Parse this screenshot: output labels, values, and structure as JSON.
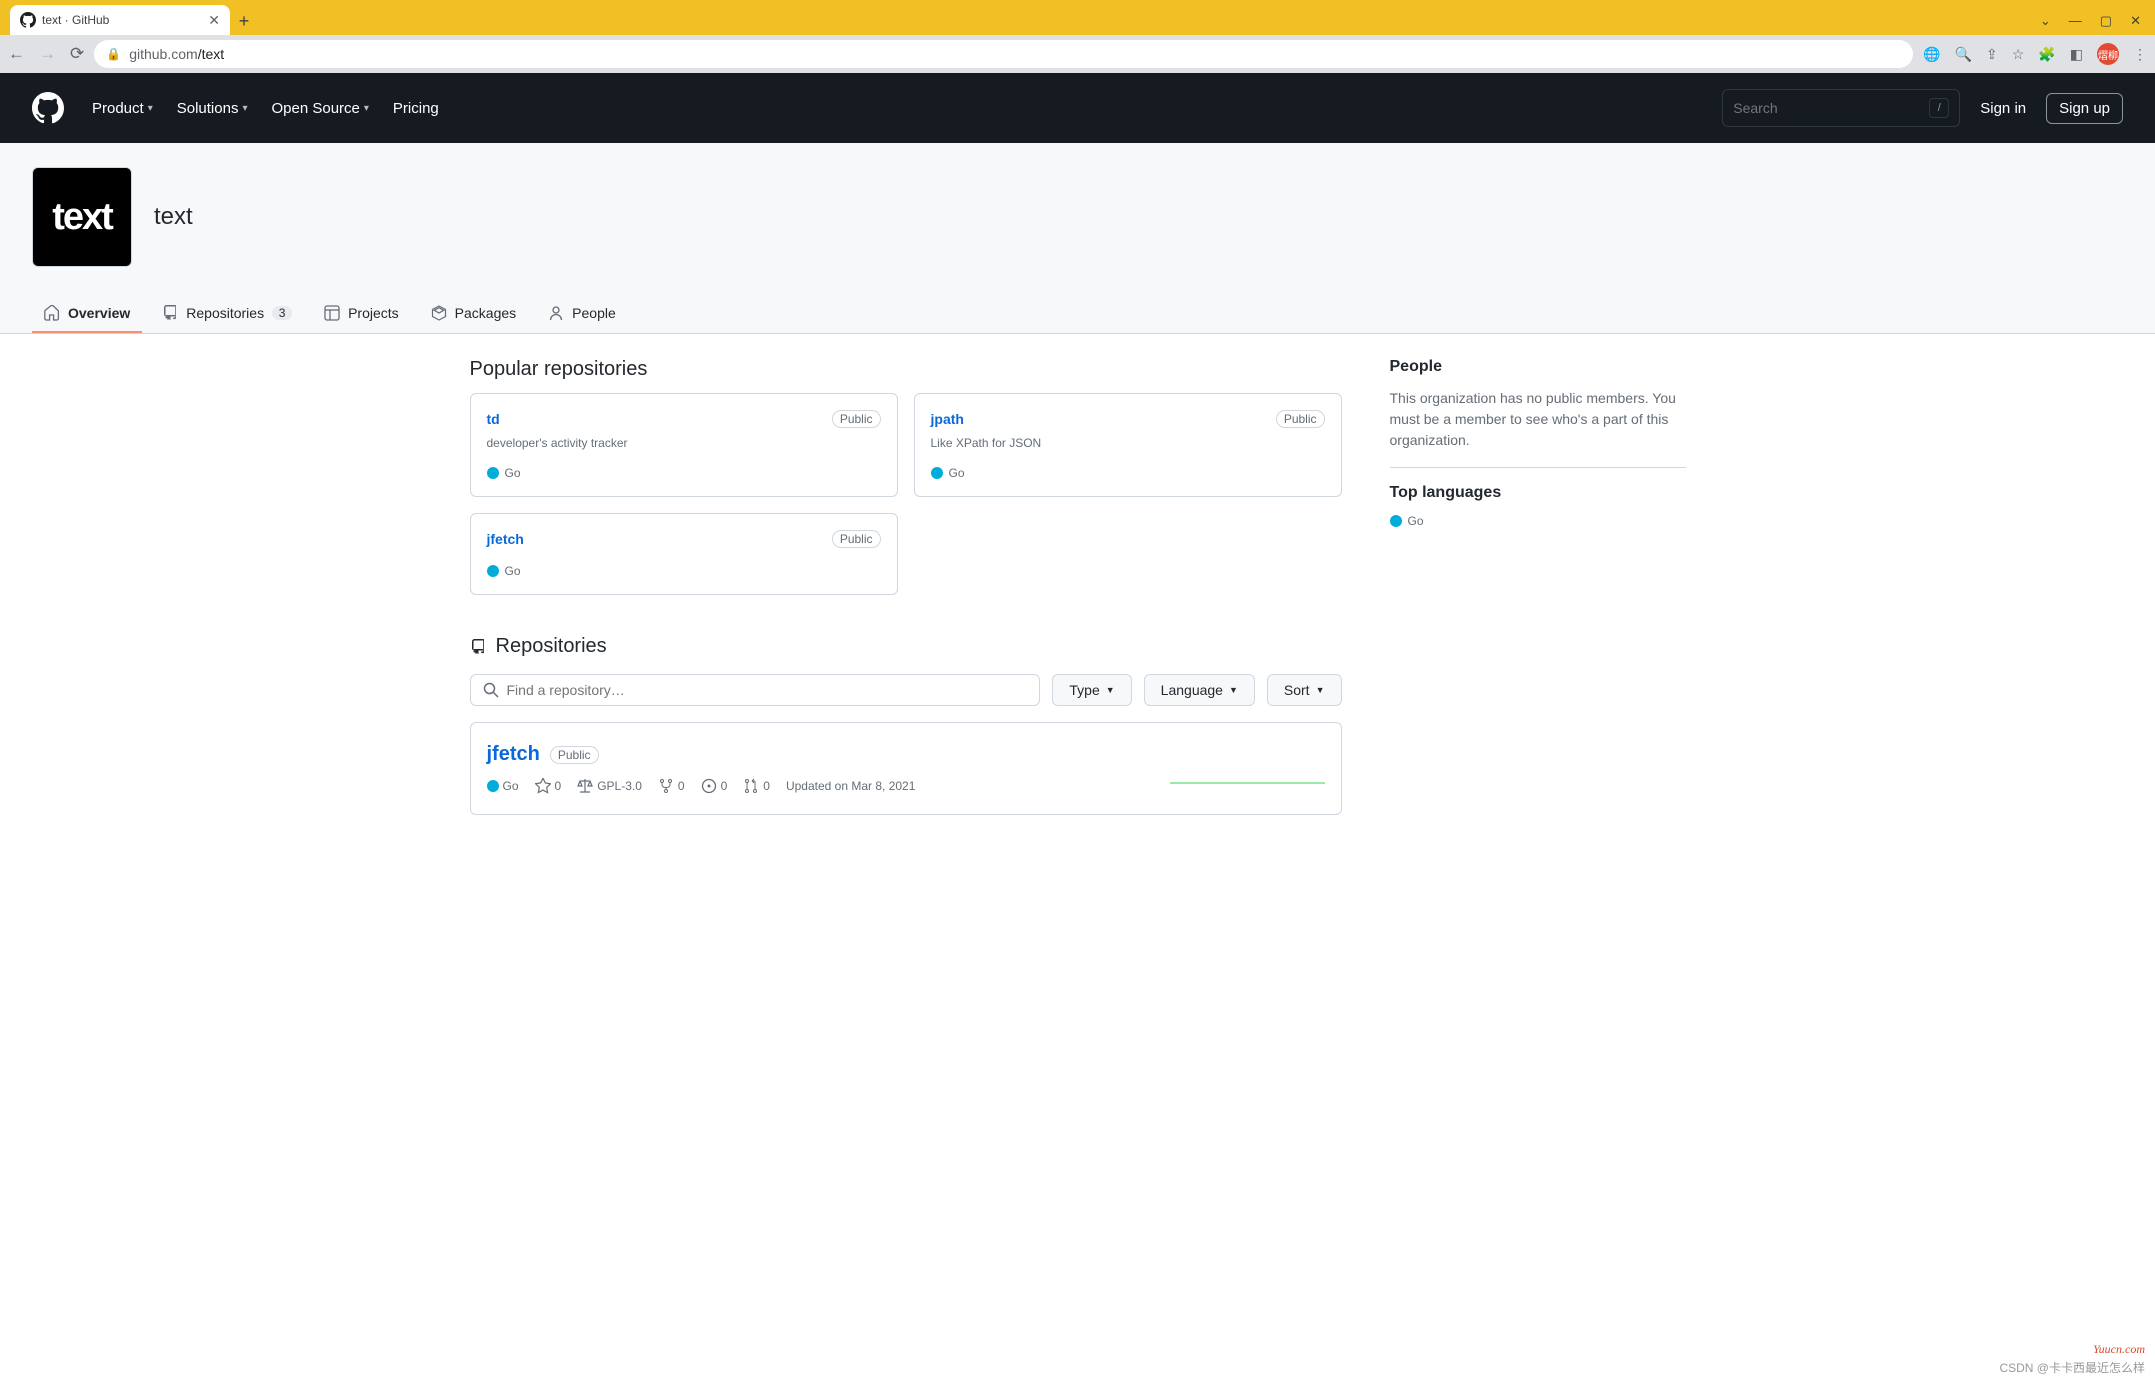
{
  "browser": {
    "tab_title": "text · GitHub",
    "url_host": "github.com",
    "url_path": "/text"
  },
  "gh_header": {
    "nav": [
      "Product",
      "Solutions",
      "Open Source",
      "Pricing"
    ],
    "search_placeholder": "Search",
    "slash": "/",
    "sign_in": "Sign in",
    "sign_up": "Sign up"
  },
  "org": {
    "avatar_text": "text",
    "name": "text",
    "tabs": [
      {
        "label": "Overview",
        "count": null,
        "selected": true
      },
      {
        "label": "Repositories",
        "count": "3",
        "selected": false
      },
      {
        "label": "Projects",
        "count": null,
        "selected": false
      },
      {
        "label": "Packages",
        "count": null,
        "selected": false
      },
      {
        "label": "People",
        "count": null,
        "selected": false
      }
    ]
  },
  "popular": {
    "heading": "Popular repositories",
    "repos": [
      {
        "name": "td",
        "visibility": "Public",
        "desc": "developer's activity tracker",
        "lang": "Go"
      },
      {
        "name": "jpath",
        "visibility": "Public",
        "desc": "Like XPath for JSON",
        "lang": "Go"
      },
      {
        "name": "jfetch",
        "visibility": "Public",
        "desc": "",
        "lang": "Go"
      }
    ]
  },
  "repos_section": {
    "heading": "Repositories",
    "find_placeholder": "Find a repository…",
    "filters": {
      "type": "Type",
      "language": "Language",
      "sort": "Sort"
    },
    "items": [
      {
        "name": "jfetch",
        "visibility": "Public",
        "lang": "Go",
        "stars": "0",
        "license": "GPL-3.0",
        "forks": "0",
        "issues": "0",
        "pulls": "0",
        "updated": "Updated on Mar 8, 2021"
      }
    ]
  },
  "sidebar": {
    "people": {
      "heading": "People",
      "text": "This organization has no public members. You must be a member to see who's a part of this organization."
    },
    "top_languages": {
      "heading": "Top languages",
      "items": [
        "Go"
      ]
    }
  },
  "watermarks": {
    "w1": "Yuucn.com",
    "w2": "CSDN @卡卡西最近怎么样"
  }
}
